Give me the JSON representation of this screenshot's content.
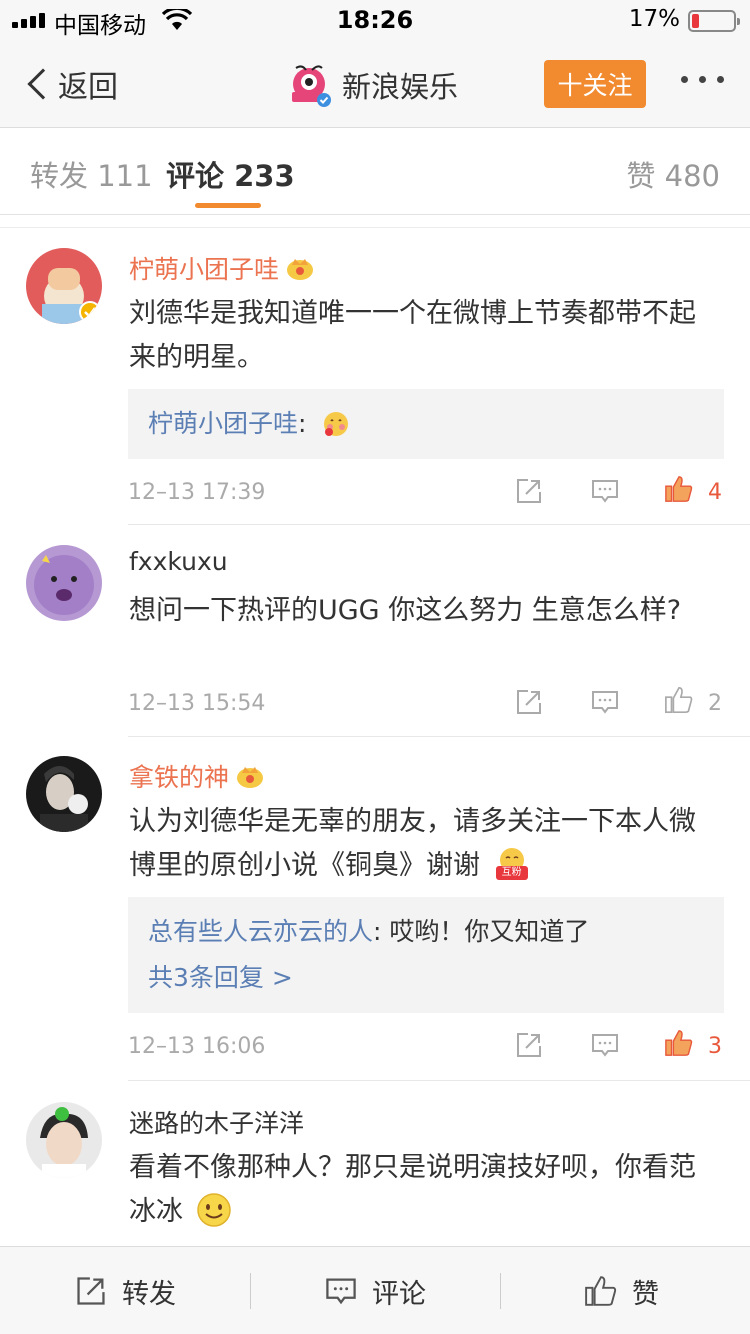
{
  "status_bar": {
    "carrier": "中国移动",
    "time": "18:26",
    "battery": "17%",
    "battery_color": "#e8383d"
  },
  "nav": {
    "back_label": "返回",
    "title": "新浪娱乐",
    "follow_label": "十关注",
    "accent_color": "#f28b30"
  },
  "tabs": {
    "repost_label": "转发",
    "repost_count": "111",
    "comment_label": "评论",
    "comment_count": "233",
    "like_label": "赞",
    "like_count": "480"
  },
  "comments": [
    {
      "name": "柠萌小团子哇",
      "text": "刘德华是我知道唯一一个在微博上节奏都带不起来的明星。",
      "reply": {
        "name": "柠萌小团子哇",
        "text": ":"
      },
      "time": "12–13 17:39",
      "likes": "4"
    },
    {
      "name": "fxxkuxu",
      "text": "想问一下热评的UGG 你这么努力 生意怎么样?",
      "time": "12–13 15:54",
      "likes": "2"
    },
    {
      "name": "拿铁的神",
      "text": "认为刘德华是无辜的朋友，请多关注一下本人微博里的原创小说《铜臭》谢谢",
      "emoji_badge": "互粉",
      "reply": {
        "name": "总有些人云亦云的人",
        "text": ": 哎哟！你又知道了",
        "more": "共3条回复 >"
      },
      "time": "12–13 16:06",
      "likes": "3"
    },
    {
      "name": "迷路的木子洋洋",
      "text": "看着不像那种人？那只是说明演技好呗，你看范冰冰"
    }
  ],
  "bottom_bar": {
    "repost": "转发",
    "comment": "评论",
    "like": "赞"
  },
  "colors": {
    "vip_name": "#eb7350",
    "link": "#5b7fb4",
    "like_active": "#e8593c"
  }
}
